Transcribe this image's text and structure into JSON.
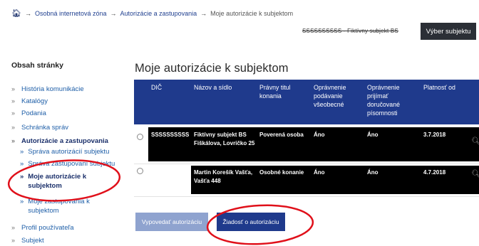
{
  "breadcrumb": {
    "home_icon": "home-icon",
    "items": [
      "Osobná internetová zóna",
      "Autorizácie a zastupovania",
      "Moje autorizácie k subjektom"
    ],
    "separator": "→"
  },
  "header": {
    "struck_subject_text": "SSSSSSSSSS - Fiktívny subjekt BS",
    "select_subject_label": "Výber subjektu"
  },
  "sidebar": {
    "title": "Obsah stránky",
    "items": [
      {
        "label": "História komunikácie"
      },
      {
        "label": "Katalógy"
      },
      {
        "label": "Podania"
      },
      {
        "label": "Schránka správ"
      },
      {
        "label": "Autorizácie a zastupovania",
        "expanded": true,
        "children": [
          {
            "label": "Správa autorizácií subjektu"
          },
          {
            "label": "Správa zastupovaní subjektu"
          },
          {
            "label": "Moje autorizácie k subjektom",
            "active": true
          },
          {
            "label": "Moje zastupovania k subjektom"
          }
        ]
      },
      {
        "label": "Profil používateľa"
      },
      {
        "label": "Subjekt"
      }
    ]
  },
  "main": {
    "title": "Moje autorizácie k subjektom",
    "table": {
      "headers": [
        "DIČ",
        "Názov a sídlo",
        "Právny titul konania",
        "Oprávnenie podávanie všeobecné",
        "Oprávnenie prijímať doručované písomnosti",
        "Platnosť od"
      ],
      "rows": [
        {
          "dic": "SSSSSSSSSS",
          "nazov": "Fiktívny subjekt BS Fiškálova, Lovričko 25",
          "titul": "Poverená osoba",
          "podavanie": "Áno",
          "prijimat": "Áno",
          "platnost": "3.7.2018"
        },
        {
          "dic": "",
          "nazov": "Martin Korešík Vašťa, Vašťa 448",
          "titul": "Osobné konanie",
          "podavanie": "Áno",
          "prijimat": "Áno",
          "platnost": "4.7.2018"
        }
      ]
    },
    "actions": {
      "revoke_label": "Vypovedať autorizáciu",
      "request_label": "Žiadosť o autorizáciu"
    }
  },
  "colors": {
    "header_blue": "#1f3a8c",
    "link_blue": "#1f5fa8",
    "annotation_red": "#e0101a",
    "button_dark": "#2b2f36",
    "button_disabled": "#8fa3cf"
  }
}
